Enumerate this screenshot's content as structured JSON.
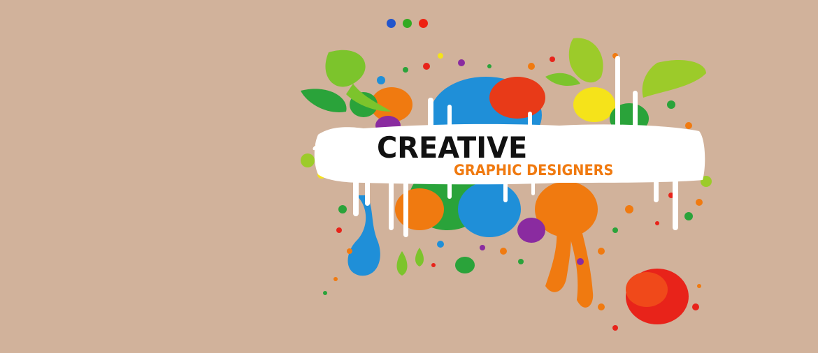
{
  "banner": {
    "title": "CREATIVE",
    "subtitle": "GRAPHIC DESIGNERS",
    "logo_name": "creative-graphic-designers-splash"
  },
  "slider": {
    "active_index": 2,
    "total": 3,
    "dot_colors": [
      "#2255cc",
      "#33aa22",
      "#ee2211"
    ]
  },
  "colors": {
    "background": "#d1b29b",
    "title": "#111111",
    "subtitle": "#f07a10"
  }
}
